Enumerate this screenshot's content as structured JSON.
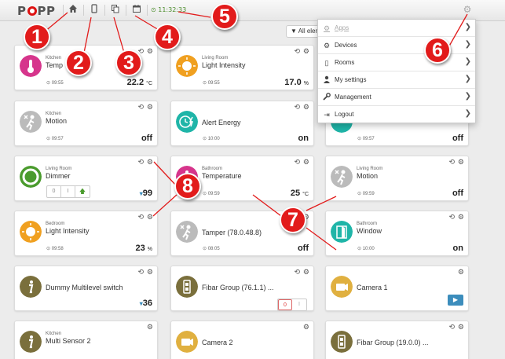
{
  "topbar": {
    "logo": {
      "pre": "P",
      "post": "PP"
    },
    "clock": "⊙ 11:32:33",
    "icons": [
      "home-icon",
      "mobile-icon",
      "copy-icon",
      "calendar-icon",
      "gear-icon"
    ]
  },
  "filter": {
    "label": "▼ All eleme"
  },
  "menu": {
    "items": [
      {
        "label": "Apps",
        "icon": "apps-icon",
        "glyph": "⚙"
      },
      {
        "label": "Devices",
        "icon": "gears-icon",
        "glyph": "⚙"
      },
      {
        "label": "Rooms",
        "icon": "rooms-icon",
        "glyph": "▯"
      },
      {
        "label": "My settings",
        "icon": "user-icon",
        "glyph": "👤"
      },
      {
        "label": "Management",
        "icon": "wrench-icon",
        "glyph": "🔧"
      },
      {
        "label": "Logout",
        "icon": "logout-icon",
        "glyph": "⇥"
      }
    ],
    "chevron": "❯"
  },
  "cards": [
    {
      "room": "Kitchen",
      "title": "Temp",
      "time": "⊙ 09:55",
      "value": "22.2",
      "unit": "°C"
    },
    {
      "room": "Living Room",
      "title": "Light Intensity",
      "time": "⊙ 09:55",
      "value": "17.0",
      "unit": "%"
    },
    {
      "room": "Kitchen",
      "title": "Motion",
      "time": "⊙ 09:57",
      "value": "off",
      "unit": ""
    },
    {
      "room": "",
      "title": "Alert Energy",
      "time": "⊙ 10:00",
      "value": "on",
      "unit": ""
    },
    {
      "room": "",
      "title": "",
      "time": "⊙ 09:57",
      "value": "off",
      "unit": ""
    },
    {
      "room": "Living Room",
      "title": "Dimmer",
      "time": "",
      "value": "99",
      "unit": "",
      "prefix": "▾",
      "dimmer": [
        "0",
        "I",
        "🡅"
      ]
    },
    {
      "room": "Bathroom",
      "title": "Temperature",
      "time": "⊙ 09:59",
      "value": "25",
      "unit": "°C"
    },
    {
      "room": "Living Room",
      "title": "Motion",
      "time": "⊙ 09:59",
      "value": "off",
      "unit": ""
    },
    {
      "room": "Bedroom",
      "title": "Light Intensity",
      "time": "⊙ 09:58",
      "value": "23",
      "unit": "%"
    },
    {
      "room": "",
      "title": "Tamper (78.0.48.8)",
      "time": "⊙ 08:05",
      "value": "off",
      "unit": ""
    },
    {
      "room": "Bathroom",
      "title": "Window",
      "time": "⊙ 10:00",
      "value": "on",
      "unit": ""
    },
    {
      "room": "",
      "title": "Dummy Multilevel switch",
      "time": "",
      "value": "36",
      "unit": "",
      "prefix": "▾"
    },
    {
      "room": "",
      "title": "Fibar Group (76.1.1) ...",
      "time": "",
      "value": "",
      "unit": "",
      "switch": [
        "0",
        "I"
      ]
    },
    {
      "room": "",
      "title": "Camera 1",
      "time": "",
      "value": "",
      "unit": "",
      "camera": "▶"
    },
    {
      "room": "Kitchen",
      "title": "Multi Sensor 2",
      "time": "",
      "value": "",
      "unit": ""
    },
    {
      "room": "",
      "title": "Camera 2",
      "time": "",
      "value": "",
      "unit": ""
    },
    {
      "room": "",
      "title": "Fibar Group (19.0.0) ...",
      "time": "",
      "value": "",
      "unit": ""
    }
  ],
  "card_glyphs": {
    "history": "⟲",
    "cog": "⚙"
  },
  "annotations": [
    "1",
    "2",
    "3",
    "4",
    "5",
    "6",
    "7",
    "8"
  ],
  "colors": {
    "badge": "#e21b1b",
    "accent": "#3c8dbc",
    "clock": "#4a8c2a",
    "teal": "#1fb5a8",
    "orange": "#f0a020",
    "pink": "#d6358c"
  }
}
